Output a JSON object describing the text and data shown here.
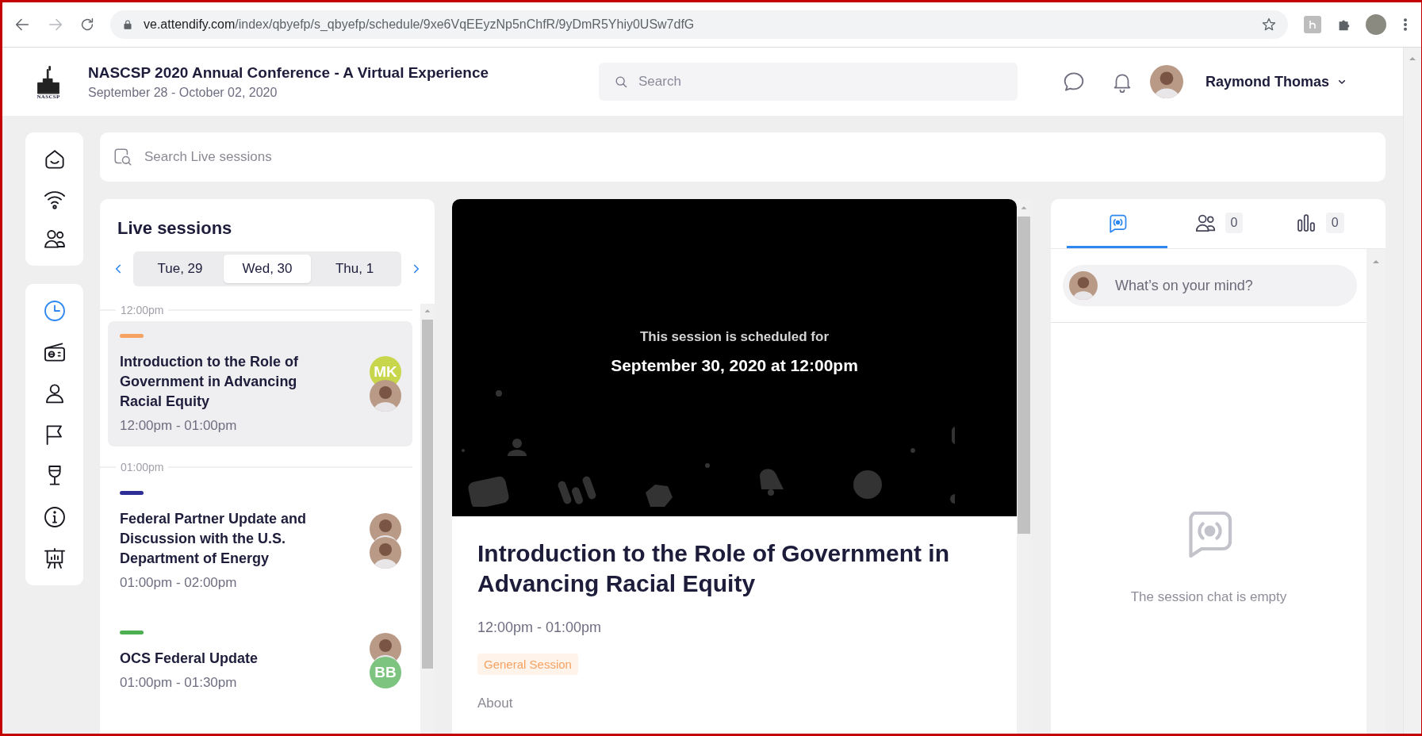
{
  "browser": {
    "url_host": "ve.attendify.com",
    "url_path": "/index/qbyefp/s_qbyefp/schedule/9xe6VqEEyzNp5nChfR/9yDmR5Yhiy0USw7dfG"
  },
  "header": {
    "logo_text": "NASCSP",
    "title": "NASCSP 2020 Annual Conference - A Virtual Experience",
    "dates": "September 28 - October 02, 2020",
    "search": {
      "placeholder": "Search"
    },
    "user": {
      "name": "Raymond Thomas"
    }
  },
  "nav": {
    "groups": [
      {
        "items": [
          {
            "selected": false
          },
          {
            "selected": false
          },
          {
            "selected": false
          }
        ]
      },
      {
        "items": [
          {
            "selected": true
          },
          {
            "selected": false
          },
          {
            "selected": false
          },
          {
            "selected": false
          },
          {
            "selected": false
          },
          {
            "selected": false
          },
          {
            "selected": false
          }
        ]
      }
    ]
  },
  "session_search": {
    "placeholder": "Search Live sessions"
  },
  "live_sessions": {
    "title": "Live sessions",
    "days": [
      {
        "label": "Tue, 29",
        "selected": false
      },
      {
        "label": "Wed, 30",
        "selected": true
      },
      {
        "label": "Thu, 1",
        "selected": false
      }
    ],
    "groups": [
      {
        "time": "12:00pm",
        "sessions": [
          {
            "title": "Introduction to the Role of Government in Advancing Racial Equity",
            "time": "12:00pm - 01:00pm",
            "color": "#f5a262",
            "selected": true,
            "speakers": [
              {
                "kind": "initials",
                "initials": "MK",
                "color": "#c8d64b"
              },
              {
                "kind": "photo"
              }
            ]
          }
        ]
      },
      {
        "time": "01:00pm",
        "sessions": [
          {
            "title": "Federal Partner Update and Discussion with the U.S. Department of Energy",
            "time": "01:00pm - 02:00pm",
            "color": "#2d2f96",
            "selected": false,
            "speakers": [
              {
                "kind": "photo"
              },
              {
                "kind": "photo"
              }
            ]
          },
          {
            "title": "OCS Federal Update",
            "time": "01:00pm - 01:30pm",
            "color": "#4caf50",
            "selected": false,
            "speakers": [
              {
                "kind": "photo"
              },
              {
                "kind": "initials",
                "initials": "BB",
                "color": "#7cc47f"
              }
            ]
          }
        ]
      }
    ]
  },
  "session": {
    "notice": "This session is scheduled for",
    "scheduled": "September 30, 2020 at 12:00pm",
    "title": "Introduction to the Role of Government in Advancing Racial Equity",
    "time": "12:00pm - 01:00pm",
    "tag": "General Session",
    "about": "About"
  },
  "chat": {
    "tabs": [
      {
        "kind": "chat",
        "selected": true
      },
      {
        "kind": "people",
        "count": "0",
        "selected": false
      },
      {
        "kind": "polls",
        "count": "0",
        "selected": false
      }
    ],
    "composer": {
      "placeholder": "What’s on your mind?"
    },
    "empty": "The session chat is empty"
  }
}
